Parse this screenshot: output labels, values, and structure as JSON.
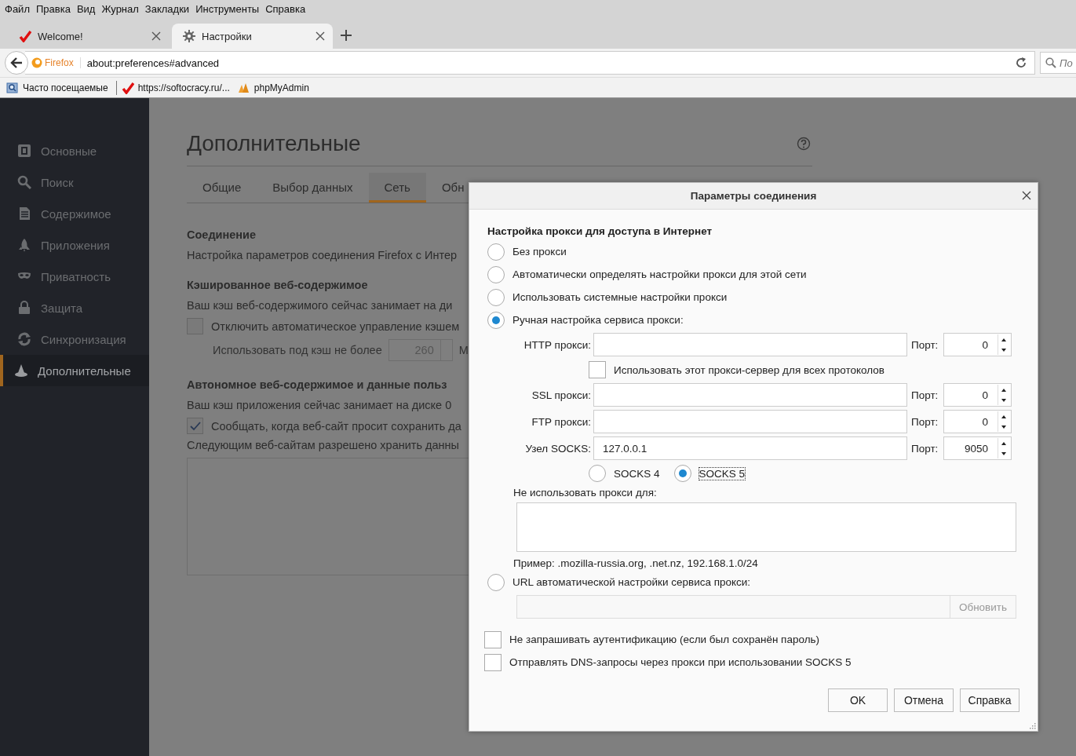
{
  "menu_bar": [
    "Файл",
    "Правка",
    "Вид",
    "Журнал",
    "Закладки",
    "Инструменты",
    "Справка"
  ],
  "tabs": [
    {
      "label": "Welcome!",
      "selected": false
    },
    {
      "label": "Настройки",
      "selected": true
    }
  ],
  "address_bar": {
    "identity": "Firefox",
    "url": "about:preferences#advanced"
  },
  "search": {
    "placeholder": "По"
  },
  "bookmarks": [
    "Часто посещаемые",
    "https://softocracy.ru/...",
    "phpMyAdmin"
  ],
  "sidebar": {
    "items": [
      {
        "label": "Основные",
        "selected": false
      },
      {
        "label": "Поиск",
        "selected": false
      },
      {
        "label": "Содержимое",
        "selected": false
      },
      {
        "label": "Приложения",
        "selected": false
      },
      {
        "label": "Приватность",
        "selected": false
      },
      {
        "label": "Защита",
        "selected": false
      },
      {
        "label": "Синхронизация",
        "selected": false
      },
      {
        "label": "Дополнительные",
        "selected": true
      }
    ]
  },
  "page": {
    "title": "Дополнительные",
    "subtabs": [
      {
        "label": "Общие",
        "selected": false
      },
      {
        "label": "Выбор данных",
        "selected": false
      },
      {
        "label": "Сеть",
        "selected": true
      },
      {
        "label": "Обн",
        "selected": false
      }
    ],
    "sections": [
      {
        "heading": "Соединение",
        "items": [
          {
            "kind": "text",
            "text": "Настройка параметров соединения Firefox с Интер"
          }
        ]
      },
      {
        "heading": "Кэшированное веб-содержимое",
        "items": [
          {
            "kind": "text",
            "text": "Ваш кэш веб-содержимого сейчас занимает на ди"
          },
          {
            "kind": "checkbox",
            "label": "Отключить автоматическое управление кэшем",
            "checked": false
          },
          {
            "kind": "spin",
            "label": "Использовать под кэш не более",
            "value": "260",
            "unit": "М"
          }
        ]
      },
      {
        "heading": "Автономное веб-содержимое и данные польз",
        "items": [
          {
            "kind": "text",
            "text": "Ваш кэш приложения сейчас занимает на диске 0"
          },
          {
            "kind": "checkbox",
            "label": "Сообщать, когда веб-сайт просит сохранить да",
            "checked": true
          },
          {
            "kind": "text",
            "text": "Следующим веб-сайтам разрешено хранить данны"
          },
          {
            "kind": "list"
          }
        ]
      }
    ]
  },
  "dialog": {
    "title": "Параметры соединения",
    "heading": "Настройка прокси для доступа в Интернет",
    "proxy_modes": [
      {
        "label": "Без прокси",
        "selected": false
      },
      {
        "label": "Автоматически определять настройки прокси для этой сети",
        "selected": false
      },
      {
        "label": "Использовать системные настройки прокси",
        "selected": false
      },
      {
        "label": "Ручная настройка сервиса прокси:",
        "selected": true
      }
    ],
    "manual_rows": [
      {
        "kind": "proxy",
        "label": "HTTP прокси:",
        "port_label": "Порт:",
        "port": "0"
      },
      {
        "kind": "checkbox",
        "label": "Использовать этот прокси-сервер для всех протоколов",
        "checked": false
      },
      {
        "kind": "proxy",
        "label": "SSL прокси:",
        "port_label": "Порт:",
        "port": "0"
      },
      {
        "kind": "proxy",
        "label": "FTP прокси:",
        "port_label": "Порт:",
        "port": "0"
      },
      {
        "kind": "proxy",
        "label": "Узел SOCKS:",
        "value": "127.0.0.1",
        "port_label": "Порт:",
        "port": "9050"
      },
      {
        "kind": "radios",
        "options": [
          {
            "label": "SOCKS 4",
            "selected": false
          },
          {
            "label": "SOCKS 5",
            "selected": true
          }
        ]
      }
    ],
    "no_proxy": {
      "label": "Не использовать прокси для:",
      "example": "Пример: .mozilla-russia.org, .net.nz, 192.168.1.0/24"
    },
    "auto_url": {
      "label": "URL автоматической настройки сервиса прокси:",
      "selected": false,
      "button": "Обновить"
    },
    "options": [
      {
        "label": "Не запрашивать аутентификацию (если был сохранён пароль)",
        "checked": false
      },
      {
        "label": "Отправлять DNS-запросы через прокси при использовании SOCKS 5",
        "checked": false
      }
    ],
    "buttons": [
      "OK",
      "Отмена",
      "Справка"
    ]
  }
}
